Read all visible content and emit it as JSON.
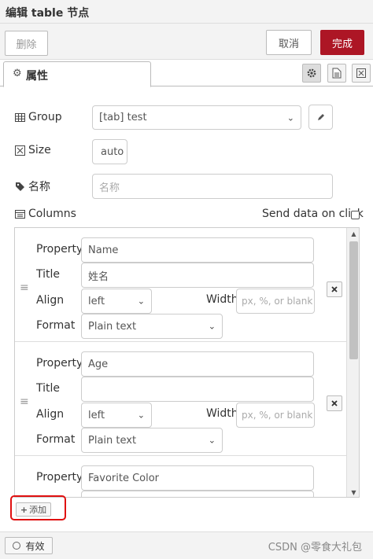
{
  "header": {
    "title": "编辑 table 节点"
  },
  "actions": {
    "delete_label": "删除",
    "cancel_label": "取消",
    "done_label": "完成"
  },
  "tabs": {
    "properties_label": "属性"
  },
  "form": {
    "group": {
      "label": "Group",
      "value": "[tab] test"
    },
    "size": {
      "label": "Size",
      "value": "auto"
    },
    "name": {
      "label": "名称",
      "placeholder": "名称"
    },
    "columns": {
      "label": "Columns",
      "send_data_label": "Send data on click"
    }
  },
  "column_labels": {
    "property": "Property",
    "title": "Title",
    "align": "Align",
    "width": "Width",
    "format": "Format",
    "width_placeholder": "px, %, or blank"
  },
  "column_items": [
    {
      "property": "Name",
      "title": "姓名",
      "align": "left",
      "format": "Plain text"
    },
    {
      "property": "Age",
      "title": "",
      "align": "left",
      "format": "Plain text"
    },
    {
      "property": "Favorite Color"
    }
  ],
  "add_label": "添加",
  "footer": {
    "enabled_label": "有效",
    "watermark": "CSDN @零食大礼包"
  },
  "colors": {
    "primary": "#ad1625",
    "highlight": "#e01010"
  }
}
